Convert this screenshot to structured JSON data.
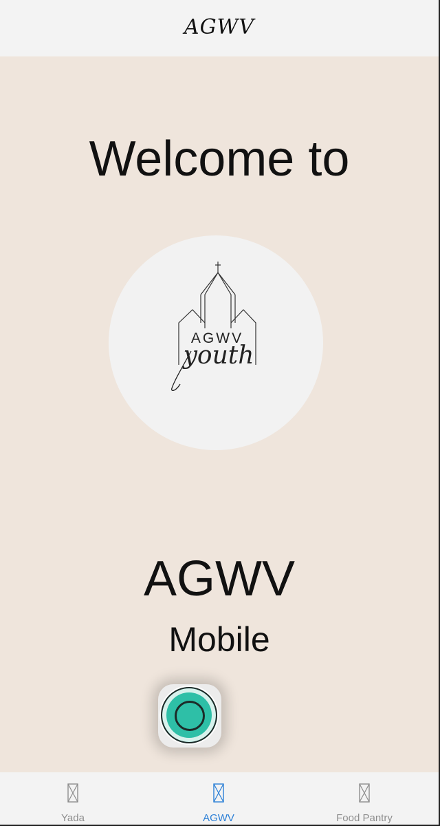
{
  "header": {
    "title": "AGWV"
  },
  "main": {
    "welcome_text": "Welcome to",
    "logo": {
      "text_top": "AGWV",
      "text_script": "youth"
    },
    "app_name": "AGWV",
    "app_subtitle": "Mobile"
  },
  "colors": {
    "background": "#efe5dc",
    "accent": "#2ebfa7",
    "active_nav": "#2b7fd6"
  },
  "bottom_nav": {
    "items": [
      {
        "label": "Yada",
        "icon": "image-placeholder-icon",
        "active": false
      },
      {
        "label": "AGWV",
        "icon": "image-placeholder-icon",
        "active": true
      },
      {
        "label": "Food Pantry",
        "icon": "image-placeholder-icon",
        "active": false
      }
    ]
  }
}
